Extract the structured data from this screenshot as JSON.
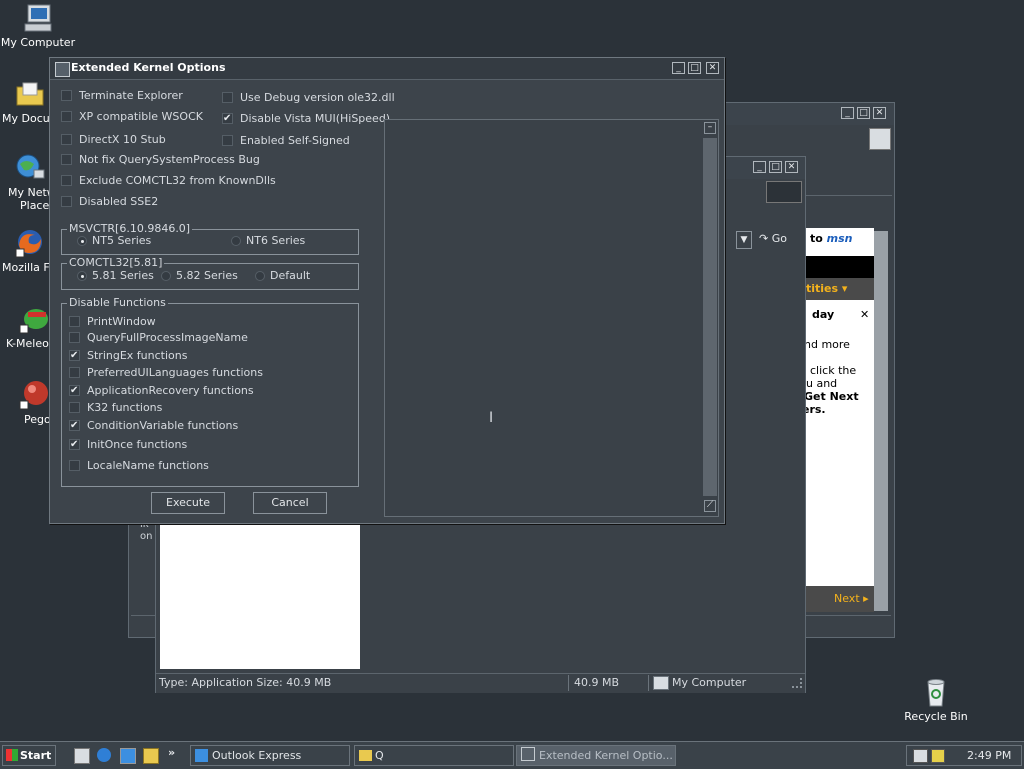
{
  "desktop": {
    "icons": {
      "my_computer": "My Computer",
      "my_documents": "My Docum",
      "my_network": "My Netw",
      "my_network_2": "Places",
      "mozilla": "Mozilla Fir",
      "kmeleon": "K-Meleon",
      "pego": "Pego",
      "recycle": "Recycle Bin"
    }
  },
  "background": {
    "explorer_status_left": "Type: Application Size: 40.9 MB",
    "explorer_status_size": "40.9 MB",
    "explorer_status_zone": "My Computer",
    "ie_go": "Go",
    "ie_text_trunc": "ıк on",
    "msn": {
      "brand_to": "to",
      "brand_msn": "msn",
      "activities": "tities",
      "day": "day",
      "more": "nd more",
      "line1": "click the",
      "line2": "u and",
      "line3": "Get Next",
      "line4": "ers.",
      "next": "Next"
    }
  },
  "dialog": {
    "title": "Extended Kernel Options",
    "left_checks": [
      {
        "label": "Terminate Explorer",
        "checked": false
      },
      {
        "label": "XP compatible WSOCK",
        "checked": false
      },
      {
        "label": "DirectX 10 Stub",
        "checked": false
      },
      {
        "label": "Not fix QuerySystemProcess Bug",
        "checked": false
      },
      {
        "label": "Exclude COMCTL32 from KnownDlls",
        "checked": false
      },
      {
        "label": "Disabled SSE2",
        "checked": false
      }
    ],
    "right_checks": [
      {
        "label": "Use Debug version ole32.dll",
        "checked": false
      },
      {
        "label": "Disable Vista MUI(HiSpeed)",
        "checked": true
      },
      {
        "label": "Enabled Self-Signed",
        "checked": false
      }
    ],
    "msvcrt": {
      "caption": "MSVCTR[6.10.9846.0]",
      "options": [
        {
          "label": "NT5 Series",
          "selected": true
        },
        {
          "label": "NT6 Series",
          "selected": false
        }
      ]
    },
    "comctl": {
      "caption": "COMCTL32[5.81]",
      "options": [
        {
          "label": "5.81 Series",
          "selected": true
        },
        {
          "label": "5.82 Series",
          "selected": false
        },
        {
          "label": "Default",
          "selected": false
        }
      ]
    },
    "disable_functions": {
      "caption": "Disable Functions",
      "items": [
        {
          "label": "PrintWindow",
          "checked": false
        },
        {
          "label": "QueryFullProcessImageName",
          "checked": false
        },
        {
          "label": "StringEx functions",
          "checked": true
        },
        {
          "label": "PreferredUILanguages functions",
          "checked": false
        },
        {
          "label": "ApplicationRecovery functions",
          "checked": true
        },
        {
          "label": "K32 functions",
          "checked": false
        },
        {
          "label": "ConditionVariable functions",
          "checked": true
        },
        {
          "label": "InitOnce functions",
          "checked": true
        },
        {
          "label": "LocaleName functions",
          "checked": false
        }
      ]
    },
    "execute_label": "Execute",
    "cancel_label": "Cancel"
  },
  "taskbar": {
    "start_label": "Start",
    "tasks": [
      {
        "label": "Outlook Express",
        "active": false
      },
      {
        "label": "Q",
        "active": false
      },
      {
        "label": "Extended Kernel Optio...",
        "active": true
      }
    ],
    "clock": "2:49 PM"
  }
}
